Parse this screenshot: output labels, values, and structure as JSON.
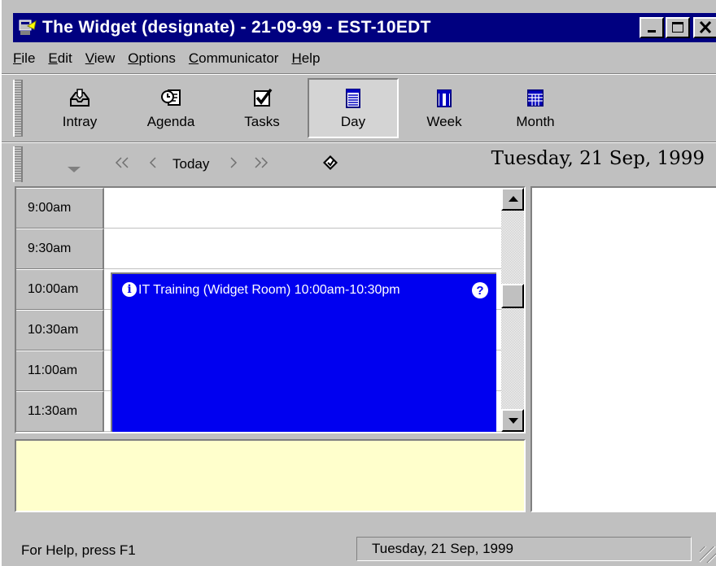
{
  "window": {
    "title": "The Widget (designate) - 21-09-99 - EST-10EDT"
  },
  "menu": {
    "items": [
      {
        "key": "F",
        "rest": "ile"
      },
      {
        "key": "E",
        "rest": "dit"
      },
      {
        "key": "V",
        "rest": "iew"
      },
      {
        "key": "O",
        "rest": "ptions"
      },
      {
        "key": "C",
        "rest": "ommunicator"
      },
      {
        "key": "H",
        "rest": "elp"
      }
    ]
  },
  "toolbar": {
    "buttons": [
      {
        "label": "Intray",
        "icon": "intray-icon"
      },
      {
        "label": "Agenda",
        "icon": "agenda-icon"
      },
      {
        "label": "Tasks",
        "icon": "tasks-icon"
      },
      {
        "label": "Day",
        "icon": "day-icon",
        "pressed": true
      },
      {
        "label": "Week",
        "icon": "week-icon"
      },
      {
        "label": "Month",
        "icon": "month-icon"
      }
    ]
  },
  "navbar": {
    "today_label": "Today",
    "current_date": "Tuesday, 21 Sep, 1999"
  },
  "dayview": {
    "times": [
      "9:00am",
      "9:30am",
      "10:00am",
      "10:30am",
      "11:00am",
      "11:30am"
    ],
    "appointment": {
      "text": "IT Training (Widget Room) 10:00am-10:30pm",
      "color": "#0000f0"
    }
  },
  "statusbar": {
    "help_text": "For Help, press F1",
    "date_text": "Tuesday, 21 Sep, 1999"
  },
  "colors": {
    "titlebar": "#000080",
    "face": "#c0c0c0",
    "notes_bg": "#ffffcc"
  }
}
